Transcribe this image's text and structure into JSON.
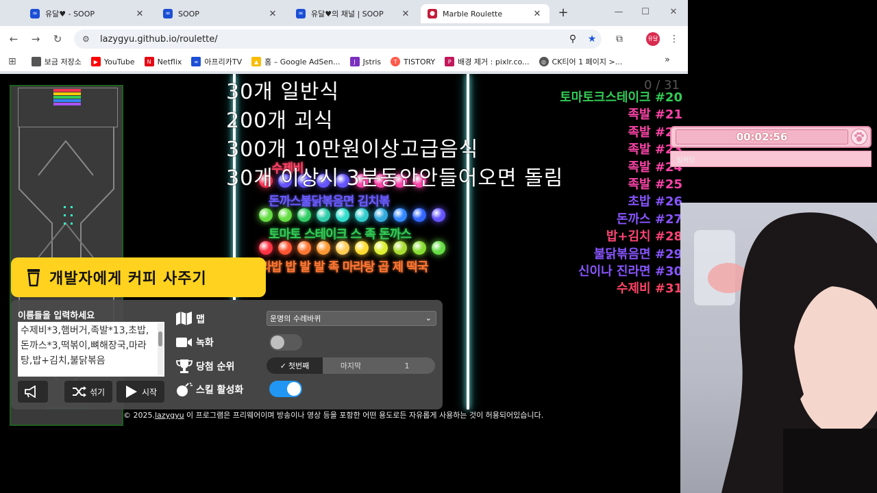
{
  "browser": {
    "tabs": [
      {
        "title": "유달♥ - SOOP",
        "favicon": "soop",
        "active": false
      },
      {
        "title": "SOOP",
        "favicon": "soop",
        "active": false
      },
      {
        "title": "유달♥의 채널 | SOOP",
        "favicon": "soop",
        "active": false
      },
      {
        "title": "Marble Roulette",
        "favicon": "marble",
        "active": true
      }
    ],
    "url": "lazygyu.github.io/roulette/",
    "profile": "유달",
    "bookmarks": [
      {
        "label": "보금 저장소",
        "icon": "folder-icon",
        "color": "#555555"
      },
      {
        "label": "YouTube",
        "icon": "youtube-icon",
        "color": "#ff0000"
      },
      {
        "label": "Netflix",
        "icon": "netflix-icon",
        "color": "#e50914"
      },
      {
        "label": "아프리카TV",
        "icon": "afreeca-icon",
        "color": "#1a4fd6"
      },
      {
        "label": "홈 – Google AdSen...",
        "icon": "adsense-icon",
        "color": "#fbbc04"
      },
      {
        "label": "Jstris",
        "icon": "jstris-icon",
        "color": "#7b2fbf"
      },
      {
        "label": "TISTORY",
        "icon": "tistory-icon",
        "color": "#ff5a4a"
      },
      {
        "label": "배경 제거 : pixlr.co...",
        "icon": "pixlr-icon",
        "color": "#c2185b"
      },
      {
        "label": "CK티어 1 페이지 >...",
        "icon": "globe-icon",
        "color": "#555555"
      }
    ]
  },
  "overlay": {
    "lines": [
      "30개 일반식",
      "200개 괴식",
      "300개 10만원이상고급음식",
      "30개 이상시 3분동안안들어오면 돌림"
    ]
  },
  "game": {
    "count": "0 / 31",
    "marble_labels": [
      {
        "text": "수제비",
        "color": "#ff4466"
      },
      {
        "text": "돈까스불닭볶음면 김치볶",
        "color": "#6a5cff"
      },
      {
        "text": "토마토 스테이크 스 족 돈까스",
        "color": "#33cc55"
      },
      {
        "text": "라밥 밥 발 발 족 마라탕 곱 제 떡국",
        "color": "#ff7733"
      }
    ],
    "ranking": [
      {
        "text": "토마토크스테이크 #20",
        "color": "#33cc55"
      },
      {
        "text": "족발 #21",
        "color": "#ff44aa"
      },
      {
        "text": "족발 #22",
        "color": "#ff44aa"
      },
      {
        "text": "족발 #23",
        "color": "#ff44aa"
      },
      {
        "text": "족발 #24",
        "color": "#ff44aa"
      },
      {
        "text": "족발 #25",
        "color": "#ff44aa"
      },
      {
        "text": "초밥 #26",
        "color": "#8855ff"
      },
      {
        "text": "돈까스 #27",
        "color": "#8855ff"
      },
      {
        "text": "밥+김치 #28",
        "color": "#ff4477"
      },
      {
        "text": "불닭볶음면 #29",
        "color": "#8855ff"
      },
      {
        "text": "신이나 진라면 #30",
        "color": "#8855ff"
      },
      {
        "text": "수제비 #31",
        "color": "#ff4466"
      }
    ]
  },
  "controls": {
    "coffee_button": "개발자에게 커피 사주기",
    "names_label": "이름들을 입력하세요",
    "names_value": "수제비*3,햄버거,족발*13,초밥,돈까스*3,떡볶이,뼈해장국,마라탕,밥+김치,불닭볶음",
    "mute_label": "",
    "shuffle_label": "섞기",
    "start_label": "시작",
    "map_label": "맵",
    "map_value": "운명의 수레바퀴",
    "record_label": "녹화",
    "record_on": false,
    "rank_label": "당첨 순위",
    "rank_first": "첫번째",
    "rank_last": "마지막",
    "rank_value": "1",
    "skill_label": "스킬 활성화",
    "skill_on": true
  },
  "footer": {
    "prefix": "© 2025.",
    "author": "lazygyu",
    "text": " 이 프로그램은 프리웨어이며 방송이나 영상 등을 포함한 어떤 용도로든 자유롭게 사용하는 것이 허용되어있습니다."
  },
  "stream": {
    "timer": "00:02:56",
    "timer_sub": "일위당"
  }
}
